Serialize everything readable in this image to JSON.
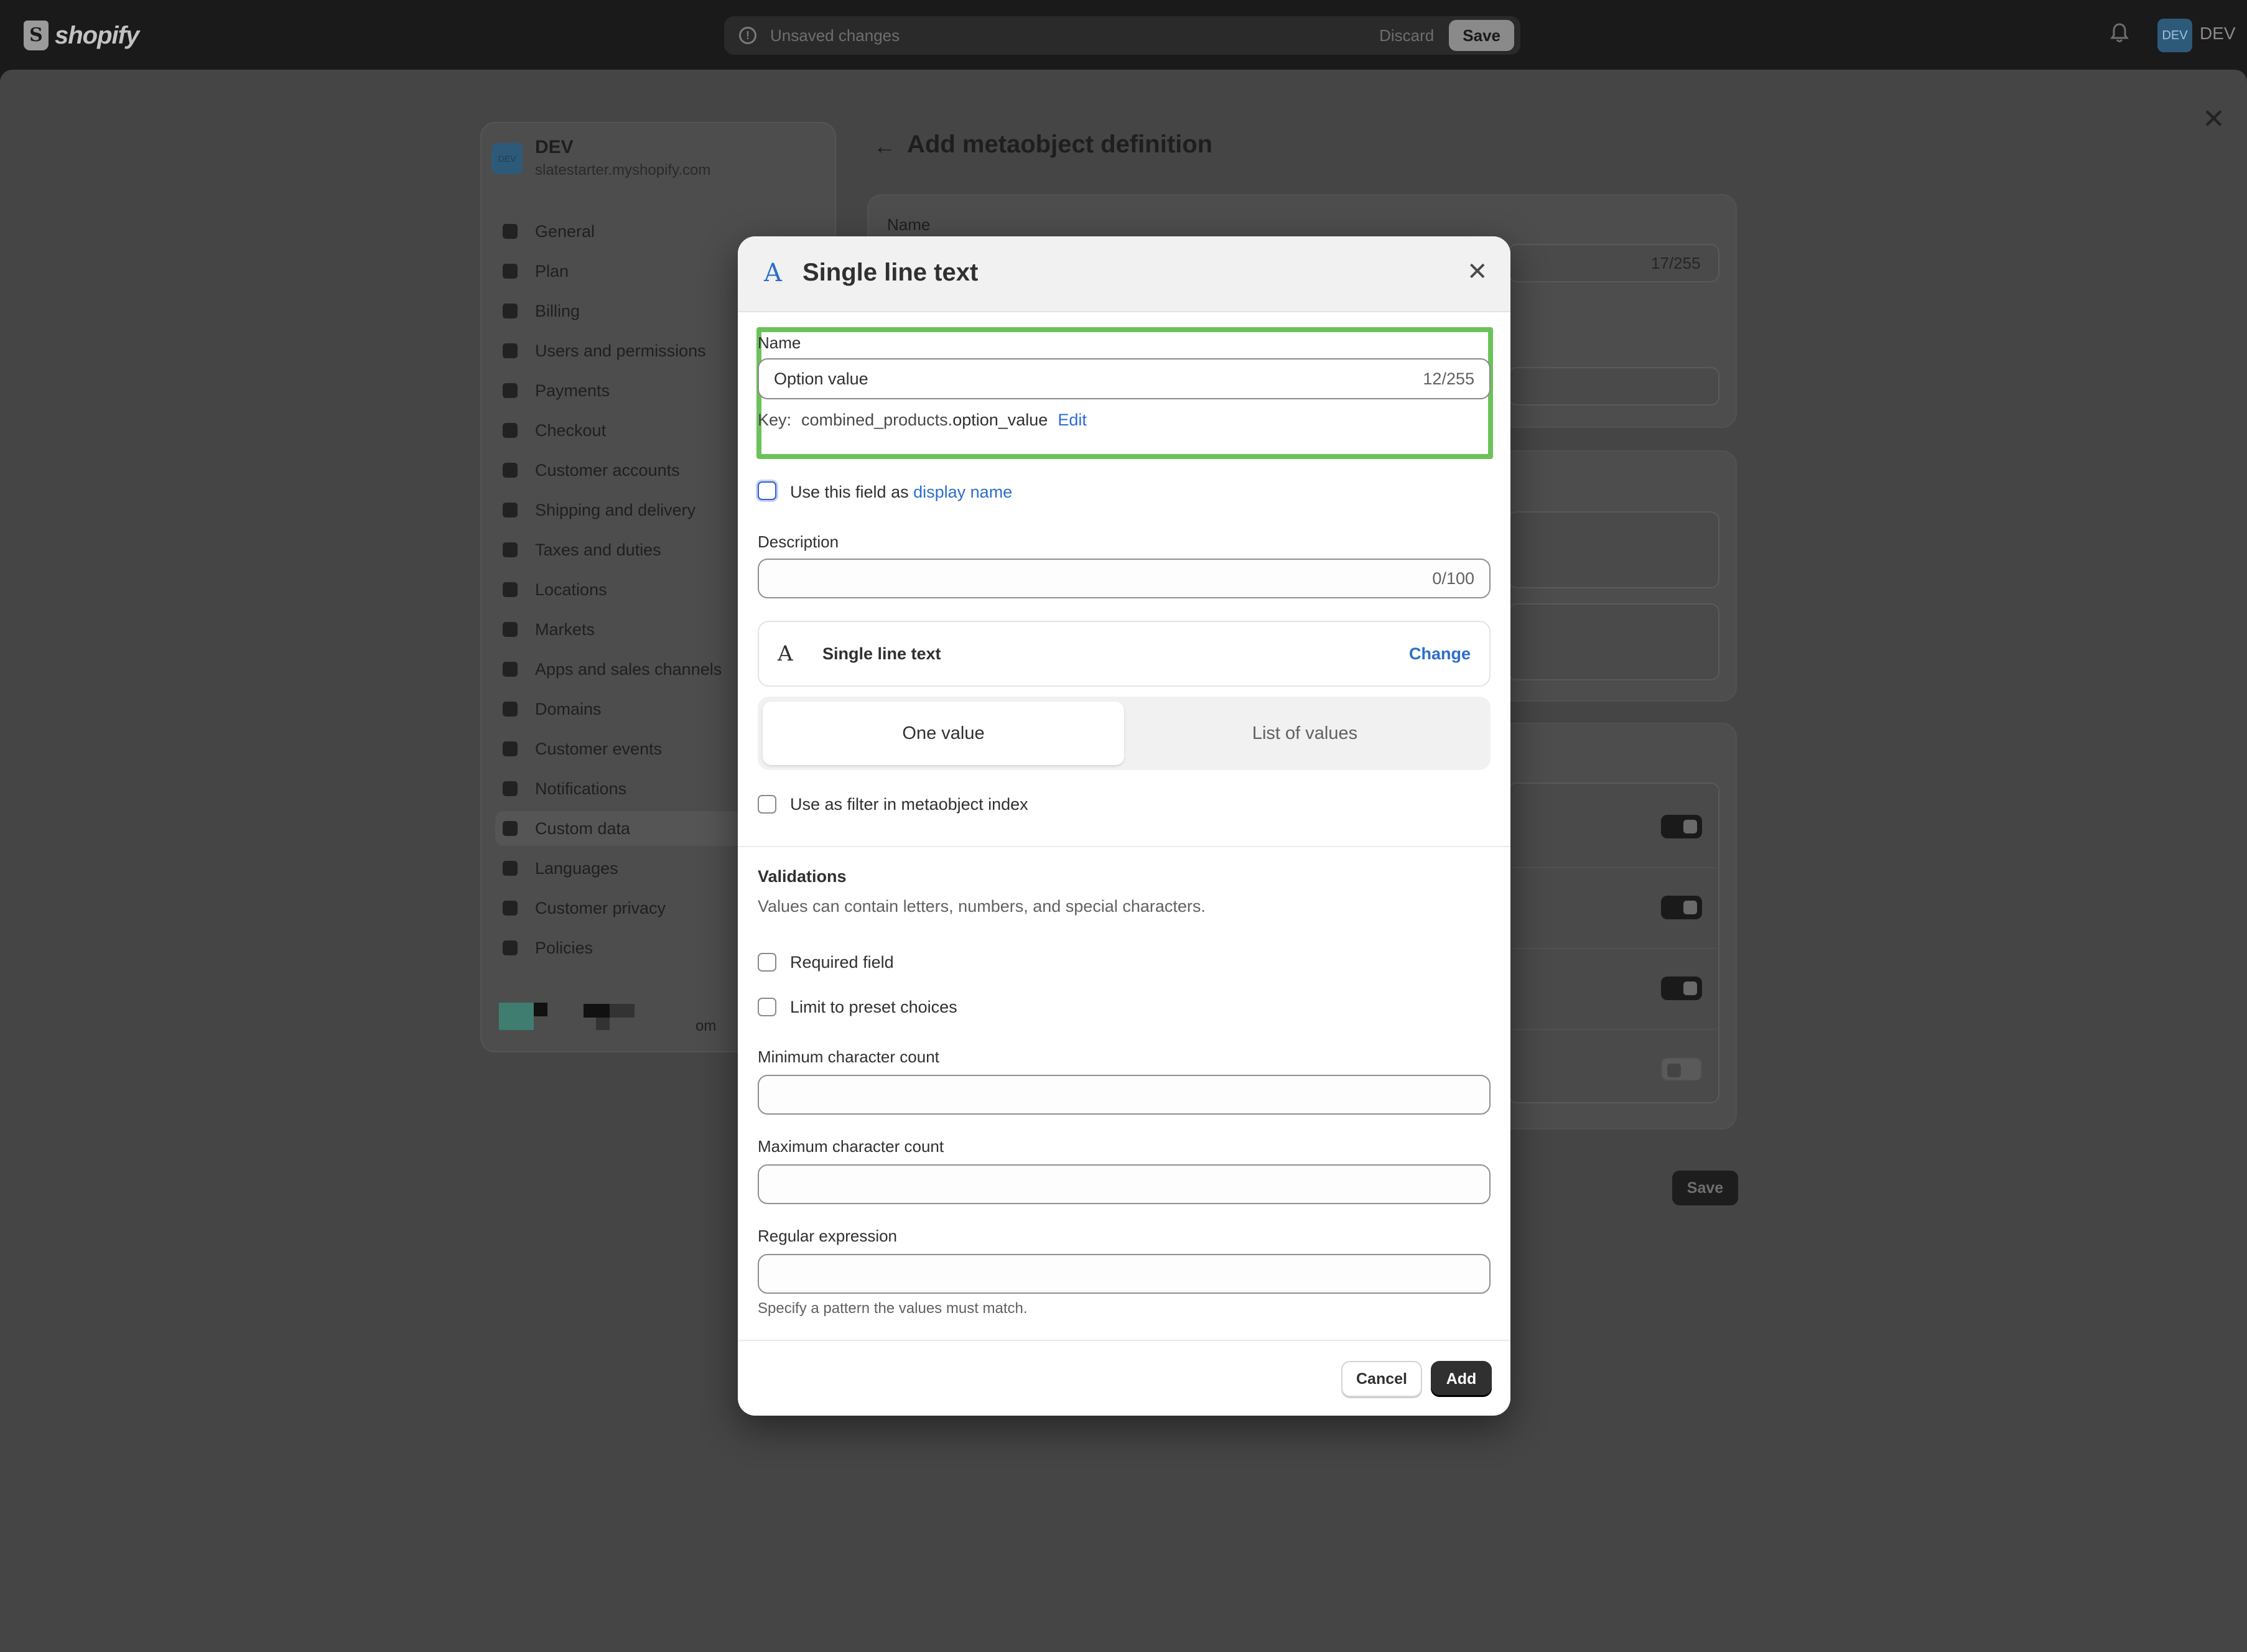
{
  "topbar": {
    "logo_text": "shopify",
    "unsaved_text": "Unsaved changes",
    "discard_label": "Discard",
    "save_label": "Save",
    "avatar_initials": "DEV",
    "store_label": "DEV"
  },
  "sidebar": {
    "store_name": "DEV",
    "store_avatar": "DEV",
    "store_domain": "slatestarter.myshopify.com",
    "items": [
      {
        "label": "General",
        "icon": "store-icon"
      },
      {
        "label": "Plan",
        "icon": "plan-icon"
      },
      {
        "label": "Billing",
        "icon": "billing-icon"
      },
      {
        "label": "Users and permissions",
        "icon": "users-icon"
      },
      {
        "label": "Payments",
        "icon": "payments-icon"
      },
      {
        "label": "Checkout",
        "icon": "cart-icon"
      },
      {
        "label": "Customer accounts",
        "icon": "person-icon"
      },
      {
        "label": "Shipping and delivery",
        "icon": "truck-icon"
      },
      {
        "label": "Taxes and duties",
        "icon": "tax-icon"
      },
      {
        "label": "Locations",
        "icon": "location-icon"
      },
      {
        "label": "Markets",
        "icon": "globe-icon"
      },
      {
        "label": "Apps and sales channels",
        "icon": "apps-icon"
      },
      {
        "label": "Domains",
        "icon": "domains-icon"
      },
      {
        "label": "Customer events",
        "icon": "events-icon"
      },
      {
        "label": "Notifications",
        "icon": "bell-icon"
      },
      {
        "label": "Custom data",
        "icon": "custom-data-icon",
        "active": true
      },
      {
        "label": "Languages",
        "icon": "languages-icon"
      },
      {
        "label": "Customer privacy",
        "icon": "lock-icon"
      },
      {
        "label": "Policies",
        "icon": "policies-icon"
      }
    ],
    "obscured_tail": "om"
  },
  "main": {
    "title": "Add metaobject definition",
    "name_label": "Name",
    "name_counter": "17/255",
    "save_label": "Save"
  },
  "modal": {
    "title": "Single line text",
    "name_label": "Name",
    "name_value": "Option value",
    "name_counter": "12/255",
    "key_label": "Key:",
    "key_prefix": "combined_products.",
    "key_suffix": "option_value",
    "key_edit": "Edit",
    "display_name_text": "Use this field as",
    "display_name_link": "display name",
    "description_label": "Description",
    "description_value": "",
    "description_counter": "0/100",
    "type_name": "Single line text",
    "type_change": "Change",
    "segment_one": "One value",
    "segment_list": "List of values",
    "filter_label": "Use as filter in metaobject index",
    "validations_title": "Validations",
    "validations_desc": "Values can contain letters, numbers, and special characters.",
    "required_label": "Required field",
    "preset_label": "Limit to preset choices",
    "min_label": "Minimum character count",
    "max_label": "Maximum character count",
    "regex_label": "Regular expression",
    "regex_help": "Specify a pattern the values must match.",
    "cancel_label": "Cancel",
    "add_label": "Add"
  },
  "colors": {
    "highlight": "#6cc25a",
    "link": "#2c6ecb",
    "primary_button": "#303030"
  }
}
